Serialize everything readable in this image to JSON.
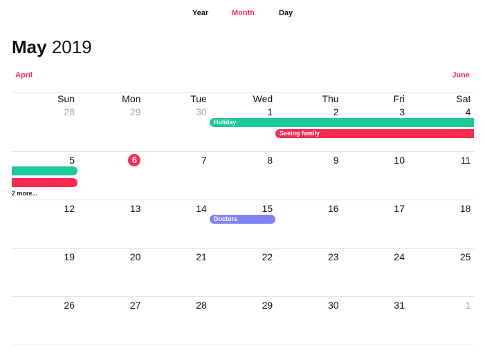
{
  "view_switch": {
    "year": "Year",
    "month": "Month",
    "day": "Day",
    "active": "Month",
    "active_color": "#ff2d55"
  },
  "title": {
    "month": "May",
    "year": "2019"
  },
  "nav": {
    "prev": "April",
    "next": "June"
  },
  "weekdays": [
    "Sun",
    "Mon",
    "Tue",
    "Wed",
    "Thu",
    "Fri",
    "Sat"
  ],
  "weeks": [
    [
      "28",
      "29",
      "30",
      "1",
      "2",
      "3",
      "4"
    ],
    [
      "5",
      "6",
      "7",
      "8",
      "9",
      "10",
      "11"
    ],
    [
      "12",
      "13",
      "14",
      "15",
      "16",
      "17",
      "18"
    ],
    [
      "19",
      "20",
      "21",
      "22",
      "23",
      "24",
      "25"
    ],
    [
      "26",
      "27",
      "28",
      "29",
      "30",
      "31",
      "1"
    ]
  ],
  "today": "6",
  "events": {
    "holiday": {
      "label": "Holiday",
      "color": "#1dc99b"
    },
    "seeing_family": {
      "label": "Seeing family",
      "color": "#fb2a51"
    },
    "doctors": {
      "label": "Doctors",
      "color": "#8382f5"
    }
  },
  "more_label": "2 more..."
}
